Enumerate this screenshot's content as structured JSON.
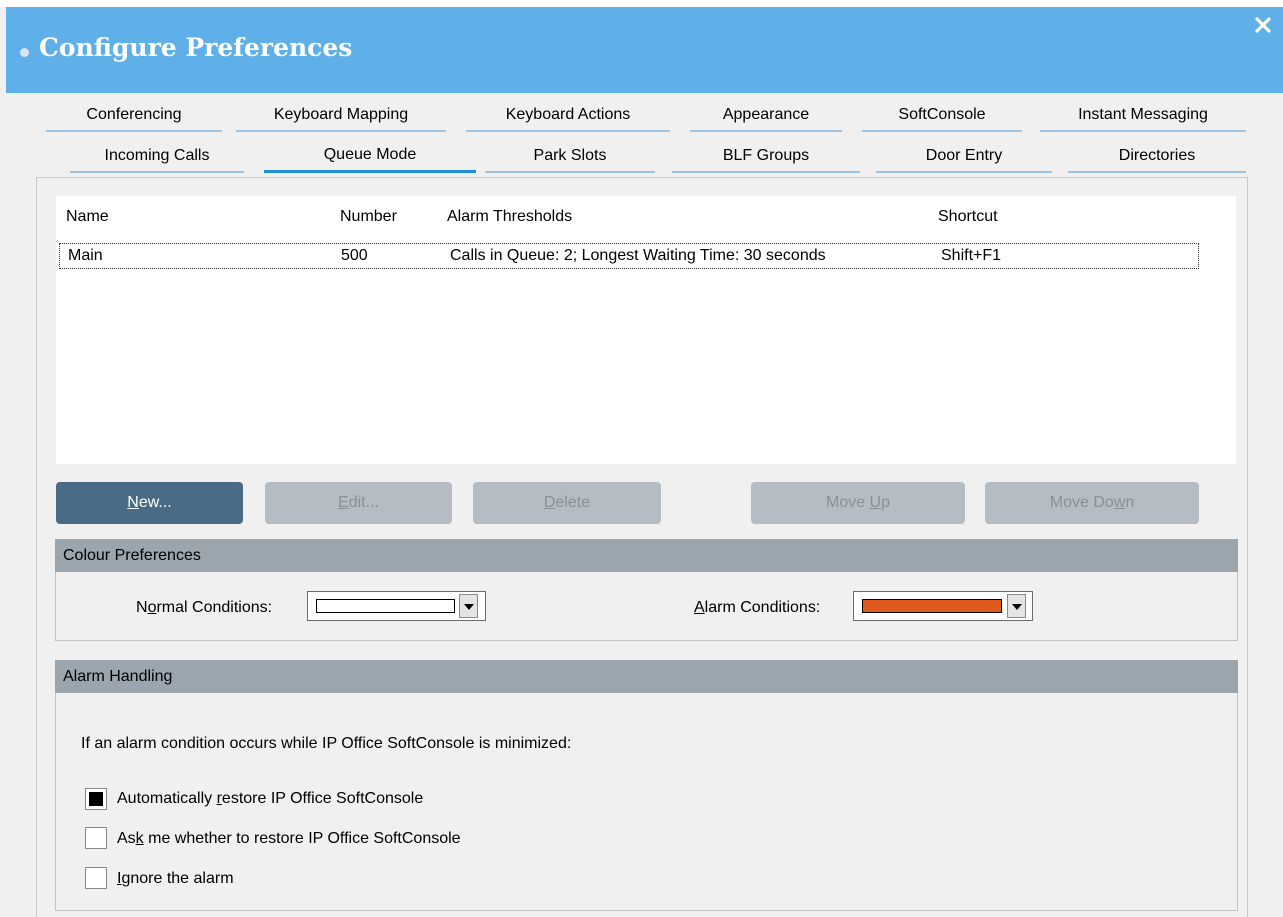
{
  "window": {
    "title": "Configure Preferences",
    "close_label": "×"
  },
  "tabs_row1": [
    "Conferencing",
    "Keyboard Mapping",
    "Keyboard Actions",
    "Appearance",
    "SoftConsole",
    "Instant Messaging"
  ],
  "tabs_row2": [
    "Incoming Calls",
    "Queue Mode",
    "Park Slots",
    "BLF Groups",
    "Door Entry",
    "Directories"
  ],
  "active_tab": "Queue Mode",
  "queue_list": {
    "columns": [
      "Name",
      "Number",
      "Alarm Thresholds",
      "Shortcut"
    ],
    "rows": [
      {
        "name": "Main",
        "number": "500",
        "alarm_thresholds": "Calls in Queue: 2; Longest Waiting Time: 30 seconds",
        "shortcut": "Shift+F1"
      }
    ]
  },
  "buttons": {
    "new": {
      "pre": "",
      "key": "N",
      "post": "ew..."
    },
    "edit": {
      "pre": "",
      "key": "E",
      "post": "dit..."
    },
    "delete": {
      "pre": "",
      "key": "D",
      "post": "elete"
    },
    "move_up": {
      "pre": "Move ",
      "key": "U",
      "post": "p"
    },
    "move_down": {
      "pre": "Move Do",
      "key": "w",
      "post": "n"
    }
  },
  "colour_preferences": {
    "header": "Colour Preferences",
    "normal": {
      "pre": "N",
      "key": "o",
      "post": "rmal Conditions:",
      "color": "#ffffff"
    },
    "alarm": {
      "pre": "",
      "key": "A",
      "post": "larm Conditions:",
      "color": "#e05a1e"
    }
  },
  "alarm_handling": {
    "header": "Alarm Handling",
    "description": "If an alarm condition occurs while IP Office SoftConsole is minimized:",
    "options": [
      {
        "pre": "Automatically ",
        "key": "r",
        "post": "estore IP Office SoftConsole",
        "checked": true
      },
      {
        "pre": "As",
        "key": "k",
        "post": " me whether to restore IP Office SoftConsole",
        "checked": false
      },
      {
        "pre": "",
        "key": "I",
        "post": "gnore the alarm",
        "checked": false
      }
    ]
  }
}
